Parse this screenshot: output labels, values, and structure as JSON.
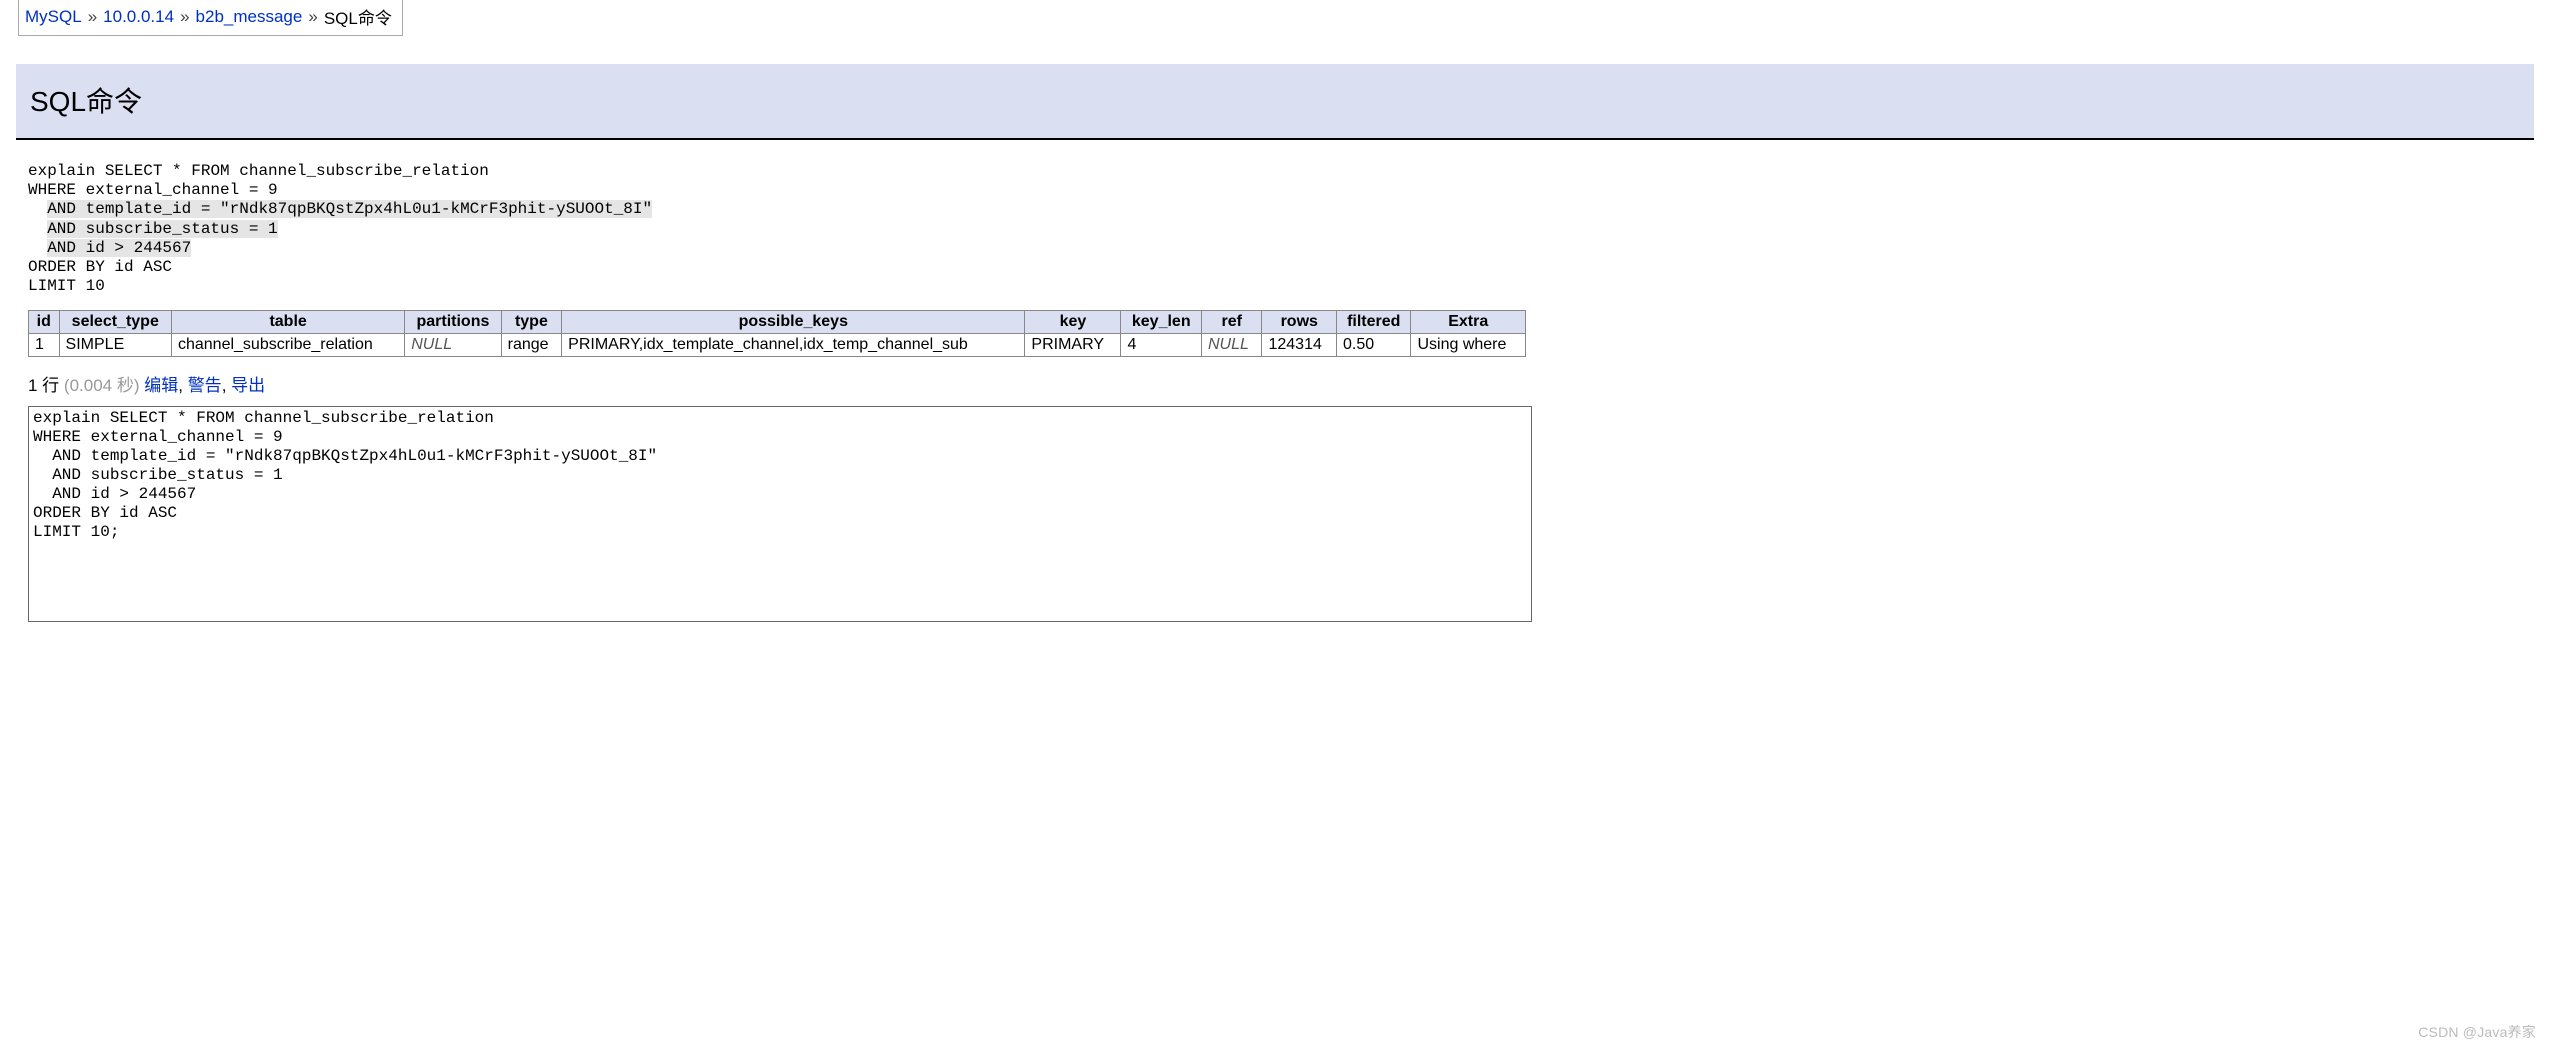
{
  "breadcrumb": {
    "items": [
      "MySQL",
      "10.0.0.14",
      "b2b_message"
    ],
    "current": "SQL命令",
    "sep": "»"
  },
  "title": "SQL命令",
  "sql_display": {
    "line1_a": "explain",
    "line1_b": " SELECT * FROM channel_subscribe_relation",
    "line2": "WHERE external_channel = 9",
    "line3_a": "  ",
    "line3_b": "AND template_id = \"rNdk87qpBKQstZpx4hL0u1-kMCrF3phit-ySUOOt_8I\"",
    "line4_a": "  ",
    "line4_b": "AND subscribe_status = 1",
    "line5_a": "  ",
    "line5_b": "AND id > 244567",
    "line6": "ORDER BY id ASC",
    "line7": "LIMIT 10"
  },
  "table": {
    "headers": [
      "id",
      "select_type",
      "table",
      "partitions",
      "type",
      "possible_keys",
      "key",
      "key_len",
      "ref",
      "rows",
      "filtered",
      "Extra"
    ],
    "rows": [
      {
        "id": "1",
        "select_type": "SIMPLE",
        "table": "channel_subscribe_relation",
        "partitions": "NULL",
        "type": "range",
        "possible_keys": "PRIMARY,idx_template_channel,idx_temp_channel_sub",
        "key": "PRIMARY",
        "key_len": "4",
        "ref": "NULL",
        "rows": "124314",
        "filtered": "0.50",
        "Extra": "Using where"
      }
    ]
  },
  "status": {
    "rows_label": "1 行",
    "time_label": " (0.004 秒) ",
    "links": {
      "edit": "编辑",
      "warn": "警告",
      "export": "导出"
    },
    "comma": ", "
  },
  "textarea_value": "explain SELECT * FROM channel_subscribe_relation\nWHERE external_channel = 9\n  AND template_id = \"rNdk87qpBKQstZpx4hL0u1-kMCrF3phit-ySUOOt_8I\"\n  AND subscribe_status = 1\n  AND id > 244567\nORDER BY id ASC\nLIMIT 10;",
  "watermark": "CSDN @Java养家"
}
